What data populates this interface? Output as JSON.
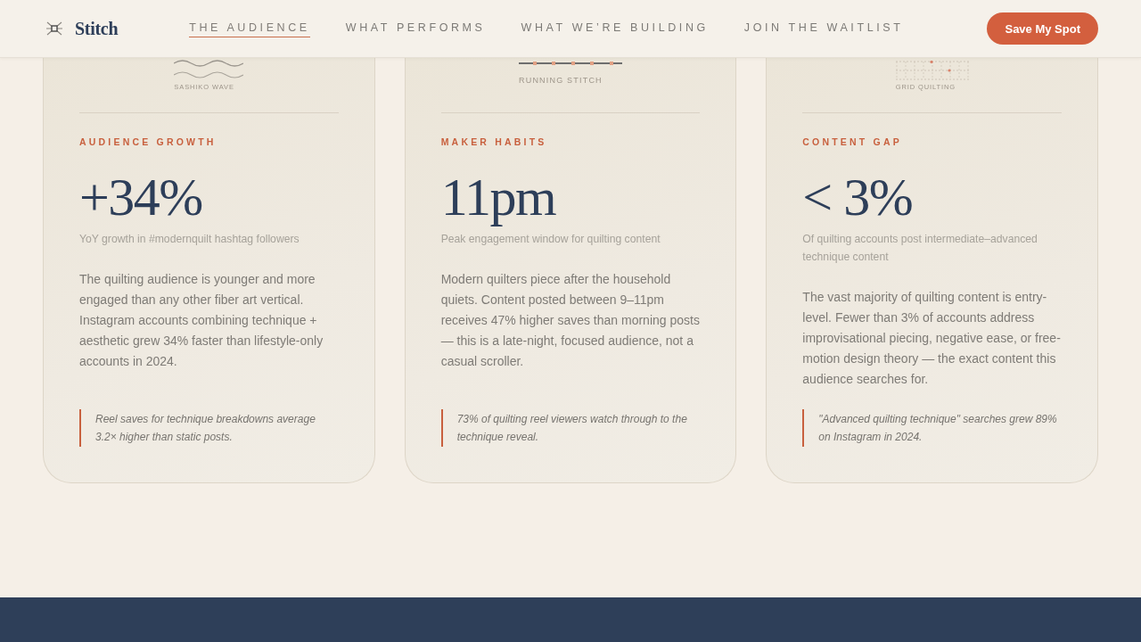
{
  "header": {
    "brand": "Stitch",
    "nav": [
      {
        "label": "THE AUDIENCE",
        "selected": true
      },
      {
        "label": "WHAT PERFORMS",
        "selected": false
      },
      {
        "label": "WHAT WE’RE BUILDING",
        "selected": false
      },
      {
        "label": "JOIN THE WAITLIST",
        "selected": false
      }
    ],
    "cta": "Save My Spot"
  },
  "cards": [
    {
      "illustration": {
        "kind": "wave",
        "label": "SASHIKO WAVE"
      },
      "eyebrow": "AUDIENCE GROWTH",
      "stat": "+34%",
      "stat_caption": "YoY growth in #modernquilt hashtag followers",
      "body": "The quilting audience is younger and more engaged than any other fiber art vertical. Instagram accounts combining technique + aesthetic grew 34% faster than lifestyle-only accounts in 2024.",
      "quote": "Reel saves for technique breakdowns average 3.2× higher than static posts."
    },
    {
      "illustration": {
        "kind": "running_stitch",
        "label": "RUNNING STITCH"
      },
      "eyebrow": "MAKER HABITS",
      "stat": "11pm",
      "stat_caption": "Peak engagement window for quilting content",
      "body": "Modern quilters piece after the household quiets. Content posted between 9–11pm receives 47% higher saves than morning posts — this is a late-night, focused audience, not a casual scroller.",
      "quote": "73% of quilting reel viewers watch through to the technique reveal."
    },
    {
      "illustration": {
        "kind": "grid",
        "label": "GRID QUILTING"
      },
      "eyebrow": "CONTENT GAP",
      "stat": "< 3%",
      "stat_caption": "Of quilting accounts post intermediate–advanced technique content",
      "body": "The vast majority of quilting content is entry-level. Fewer than 3% of accounts address improvisational piecing, negative ease, or free-motion design theory — the exact content this audience searches for.",
      "quote": "\"Advanced quilting technique\" searches grew 89% on Instagram in 2024."
    }
  ]
}
